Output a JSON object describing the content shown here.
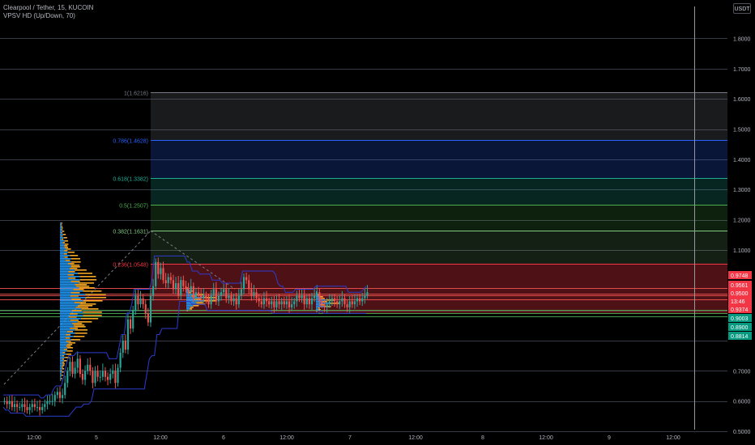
{
  "header": {
    "symbol": "Clearpool / Tether, 15, KUCOIN",
    "indicator": "VPSV HD (Up/Down, 70)",
    "currency": "USDT"
  },
  "colors": {
    "up": "#26a69a",
    "down": "#ef5350",
    "price_bar": "#f23645",
    "bull_bar": "#089981",
    "fib_1": "#787b86",
    "fib_0786": "#2962ff",
    "fib_0618": "#22ab94",
    "fib_05": "#4caf50",
    "fib_0382": "#81c784",
    "fib_0236": "#f23645",
    "vp_up": "#2196f3",
    "vp_down": "#f5a623",
    "level_line": "#ef5350",
    "support_line": "#4caf50"
  },
  "chart_data": {
    "type": "candlestick",
    "title": "Clearpool / Tether, 15, KUCOIN",
    "y_axis": {
      "ylim": [
        0.48,
        1.9
      ],
      "ticks": [
        "1.8000",
        "1.7000",
        "1.6000",
        "1.5000",
        "1.4000",
        "1.3000",
        "1.2000",
        "1.1000",
        "0.7000",
        "0.6000",
        "0.5000"
      ]
    },
    "x_axis": {
      "ticks": [
        "12:00",
        "5",
        "12:00",
        "6",
        "12:00",
        "7",
        "12:00",
        "8",
        "12:00",
        "9",
        "12:00"
      ]
    },
    "price_labels": [
      {
        "value": 0.9748,
        "text": "0.9748",
        "kind": "down"
      },
      {
        "value": 0.9561,
        "text": "0.9561",
        "kind": "down"
      },
      {
        "value": 0.95,
        "text": "0.9500",
        "kind": "price"
      },
      {
        "text": "13:46",
        "kind": "countdown"
      },
      {
        "value": 0.9374,
        "text": "0.9374",
        "kind": "down"
      },
      {
        "value": 0.9003,
        "text": "0.9003",
        "kind": "up"
      },
      {
        "value": 0.89,
        "text": "0.8900",
        "kind": "up"
      },
      {
        "value": 0.8814,
        "text": "0.8814",
        "kind": "up"
      }
    ],
    "fibonacci": [
      {
        "label": "1(1.6216)",
        "level": 1,
        "price": 1.6216,
        "color": "#787b86"
      },
      {
        "label": "0.786(1.4628)",
        "level": 0.786,
        "price": 1.4628,
        "color": "#2962ff"
      },
      {
        "label": "0.618(1.3382)",
        "level": 0.618,
        "price": 1.3382,
        "color": "#22ab94"
      },
      {
        "label": "0.5(1.2507)",
        "level": 0.5,
        "price": 1.2507,
        "color": "#4caf50"
      },
      {
        "label": "0.382(1.1631)",
        "level": 0.382,
        "price": 1.1631,
        "color": "#81c784"
      },
      {
        "label": "0.236(1.0548)",
        "level": 0.236,
        "price": 1.0548,
        "color": "#f23645"
      }
    ],
    "horizontal_levels": [
      0.9748,
      0.9561,
      0.95,
      0.9374,
      0.9003,
      0.89,
      0.8814
    ],
    "candles_close": [
      0.6,
      0.59,
      0.6,
      0.58,
      0.59,
      0.58,
      0.58,
      0.59,
      0.58,
      0.57,
      0.58,
      0.59,
      0.58,
      0.58,
      0.57,
      0.58,
      0.59,
      0.6,
      0.6,
      0.6,
      0.62,
      0.63,
      0.61,
      0.62,
      0.66,
      0.7,
      0.73,
      0.69,
      0.71,
      0.74,
      0.69,
      0.67,
      0.7,
      0.72,
      0.7,
      0.66,
      0.7,
      0.68,
      0.68,
      0.7,
      0.68,
      0.67,
      0.69,
      0.7,
      0.66,
      0.71,
      0.76,
      0.8,
      0.77,
      0.87,
      0.84,
      0.9,
      0.95,
      0.92,
      0.94,
      0.92,
      0.89,
      0.86,
      0.95,
      0.98,
      1.06,
      1.02,
      1.04,
      1.0,
      0.99,
      1.01,
      1.0,
      0.97,
      0.99,
      0.95,
      1.0,
      0.98,
      0.97,
      0.96,
      0.98,
      0.94,
      0.96,
      0.95,
      0.94,
      0.95,
      0.94,
      0.92,
      0.95,
      0.97,
      0.93,
      0.95,
      0.96,
      0.97,
      0.94,
      0.95,
      0.93,
      0.94,
      0.92,
      0.95,
      0.97,
      1.01,
      1.0,
      0.97,
      0.95,
      0.96,
      0.94,
      0.93,
      0.92,
      0.94,
      0.93,
      0.92,
      0.93,
      0.91,
      0.93,
      0.92,
      0.93,
      0.92,
      0.93,
      0.91,
      0.92,
      0.93,
      0.95,
      0.94,
      0.95,
      0.92,
      0.94,
      0.92,
      0.94,
      0.95,
      0.96,
      0.93,
      0.92,
      0.91,
      0.92,
      0.93,
      0.94,
      0.93,
      0.92,
      0.93,
      0.94,
      0.92,
      0.91,
      0.93,
      0.92,
      0.93,
      0.94,
      0.93,
      0.94,
      0.95,
      0.96
    ]
  }
}
